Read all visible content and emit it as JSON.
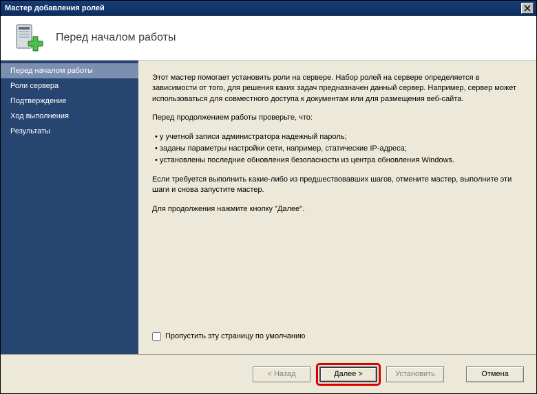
{
  "titlebar": {
    "title": "Мастер добавления ролей"
  },
  "header": {
    "title": "Перед началом работы"
  },
  "sidebar": {
    "items": [
      {
        "label": "Перед началом работы",
        "active": true
      },
      {
        "label": "Роли сервера",
        "active": false
      },
      {
        "label": "Подтверждение",
        "active": false
      },
      {
        "label": "Ход выполнения",
        "active": false
      },
      {
        "label": "Результаты",
        "active": false
      }
    ]
  },
  "content": {
    "intro": "Этот мастер помогает установить роли на сервере. Набор ролей на сервере определяется в зависимости от того, для решения каких задач предназначен данный сервер. Например, сервер может использоваться для совместного доступа к документам или для размещения веб-сайта.",
    "verify_intro": "Перед продолжением работы проверьте, что:",
    "bullets": [
      "у учетной записи администратора надежный пароль;",
      "заданы параметры настройки сети, например, статические IP-адреса;",
      "установлены последние обновления безопасности из центра обновления Windows."
    ],
    "cancel_note": "Если требуется выполнить какие-либо из предшествовавших шагов, отмените мастер, выполните эти шаги и снова запустите мастер.",
    "continue_note": "Для продолжения нажмите кнопку \"Далее\".",
    "skip_label": "Пропустить эту страницу по умолчанию"
  },
  "footer": {
    "back": "< Назад",
    "next": "Далее >",
    "install": "Установить",
    "cancel": "Отмена"
  }
}
